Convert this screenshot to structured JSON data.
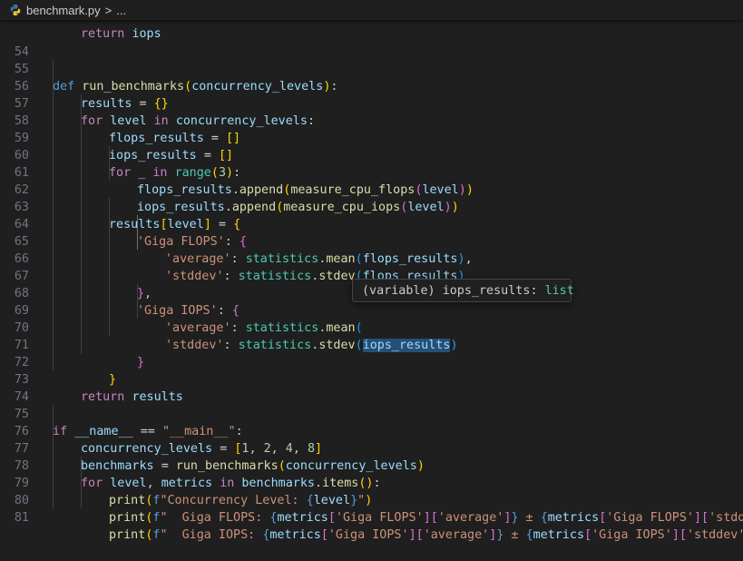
{
  "breadcrumb": {
    "file": "benchmark.py",
    "separator": ">",
    "more": "..."
  },
  "hover": {
    "kind": "(variable)",
    "name": "iops_results",
    "colon": ":",
    "type": "list"
  },
  "line_numbers": [
    "54",
    "55",
    "56",
    "57",
    "58",
    "59",
    "60",
    "61",
    "62",
    "63",
    "64",
    "65",
    "66",
    "67",
    "68",
    "69",
    "70",
    "71",
    "72",
    "73",
    "74",
    "75",
    "76",
    "77",
    "78",
    "79",
    "80",
    "81"
  ],
  "code": {
    "l53": "return iops",
    "l54": "",
    "l55": "def run_benchmarks(concurrency_levels):",
    "l56": "results = {}",
    "l57": "for level in concurrency_levels:",
    "l58": "flops_results = []",
    "l59": "iops_results = []",
    "l60": "for _ in range(3):",
    "l61": "flops_results.append(measure_cpu_flops(level))",
    "l62": "iops_results.append(measure_cpu_iops(level))",
    "l63": "results[level] = {",
    "l64": "'Giga FLOPS': {",
    "l65": "'average': statistics.mean(flops_results),",
    "l66": "'stddev': statistics.stdev(flops_results)",
    "l67": "},",
    "l68": "'Giga IOPS': {",
    "l69": "'average': statistics.mean(",
    "l70": "'stddev': statistics.stdev(iops_results)",
    "l71": "}",
    "l72": "}",
    "l73": "return results",
    "l75": "if __name__ == \"__main__\":",
    "l76": "concurrency_levels = [1, 2, 4, 8]",
    "l77": "benchmarks = run_benchmarks(concurrency_levels)",
    "l78": "for level, metrics in benchmarks.items():",
    "l79": "print(f\"Concurrency Level: {level}\")",
    "l80": "print(f\"  Giga FLOPS: {metrics['Giga FLOPS']['average']} ± {metrics['Giga FLOPS']['stddev']",
    "l81": "print(f\"  Giga IOPS: {metrics['Giga IOPS']['average']} ± {metrics['Giga IOPS']['stddev']}\")"
  }
}
